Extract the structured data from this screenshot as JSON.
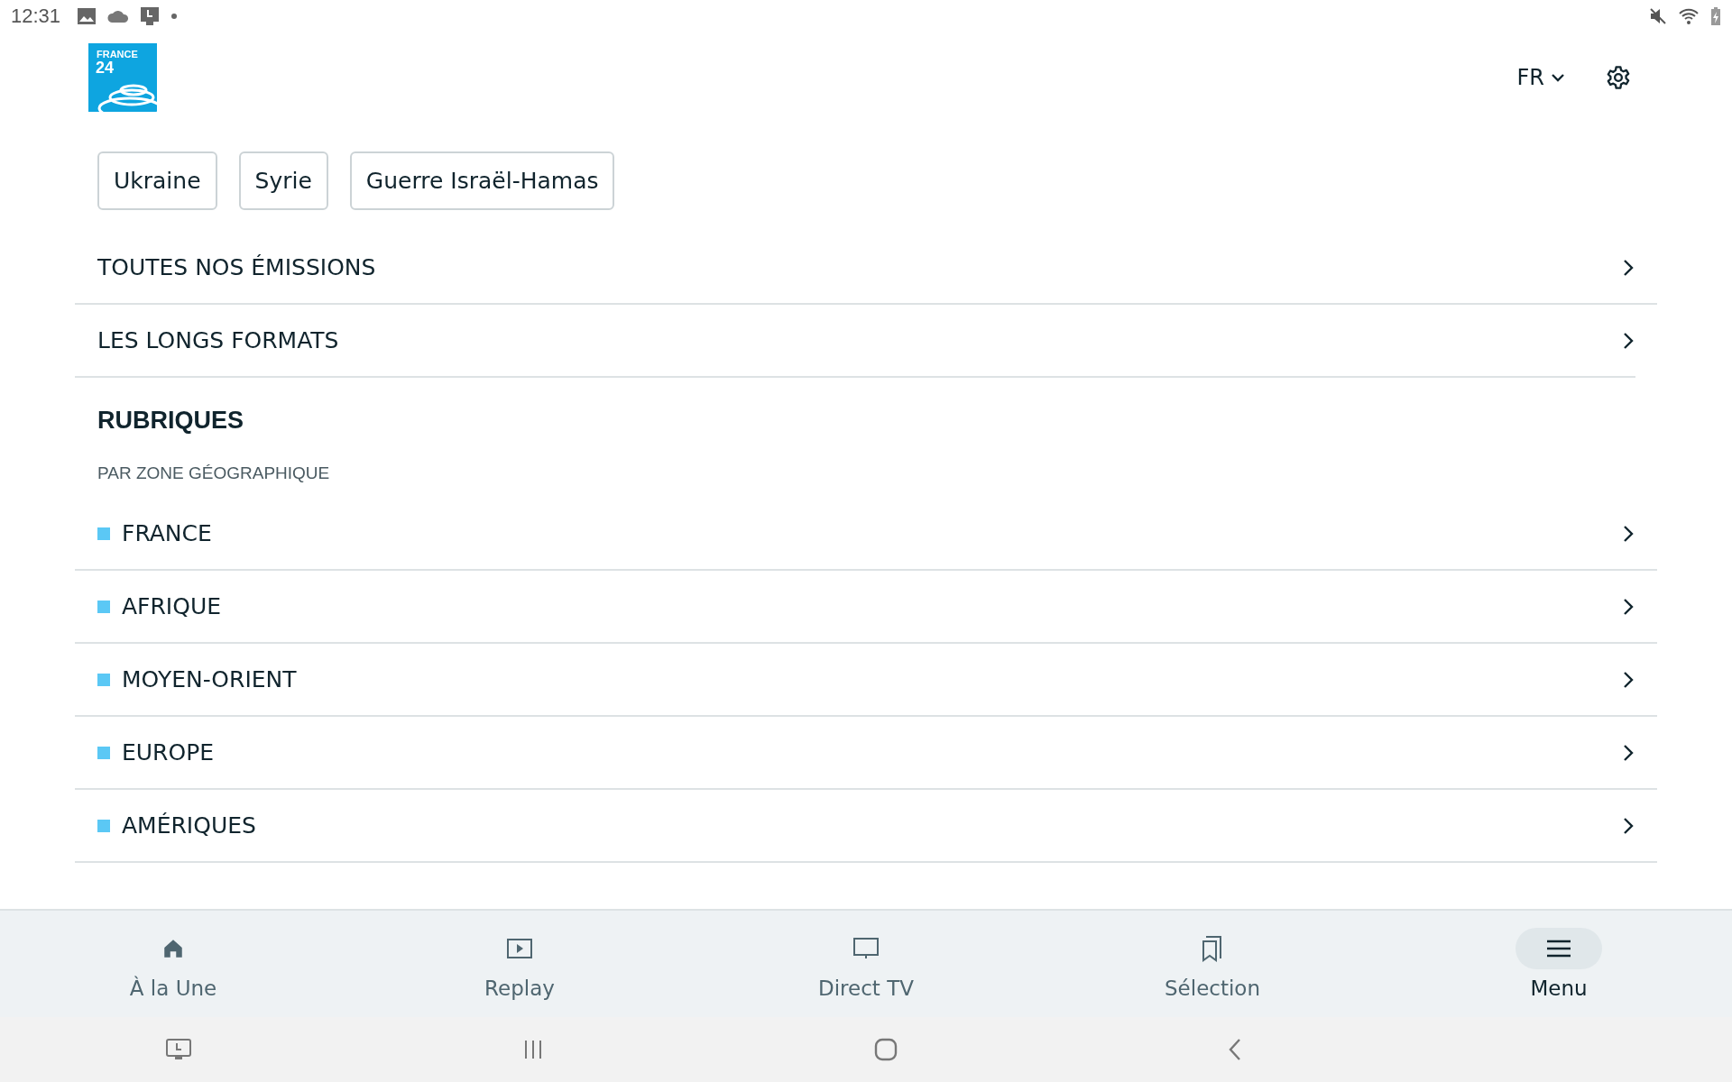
{
  "status_bar": {
    "time": "12:31"
  },
  "header": {
    "logo_line_1": "FRANCE",
    "logo_line_2": "24",
    "language": "FR"
  },
  "chips": [
    {
      "label": "Ukraine"
    },
    {
      "label": "Syrie"
    },
    {
      "label": "Guerre Israël-Hamas"
    }
  ],
  "links": [
    {
      "label": "TOUTES NOS ÉMISSIONS"
    },
    {
      "label": "LES LONGS FORMATS"
    }
  ],
  "section": {
    "title": "RUBRIQUES",
    "subtitle": "PAR ZONE GÉOGRAPHIQUE"
  },
  "regions": [
    {
      "label": "FRANCE",
      "color": "#5bc8f5"
    },
    {
      "label": "AFRIQUE",
      "color": "#5bc8f5"
    },
    {
      "label": "MOYEN-ORIENT",
      "color": "#5bc8f5"
    },
    {
      "label": "EUROPE",
      "color": "#5bc8f5"
    },
    {
      "label": "AMÉRIQUES",
      "color": "#5bc8f5"
    }
  ],
  "bottom_nav": [
    {
      "kind": "home",
      "label": "À la Une",
      "selected": false
    },
    {
      "kind": "replay",
      "label": "Replay",
      "selected": false
    },
    {
      "kind": "tv",
      "label": "Direct TV",
      "selected": false
    },
    {
      "kind": "bookmark",
      "label": "Sélection",
      "selected": false
    },
    {
      "kind": "menu",
      "label": "Menu",
      "selected": true
    }
  ]
}
